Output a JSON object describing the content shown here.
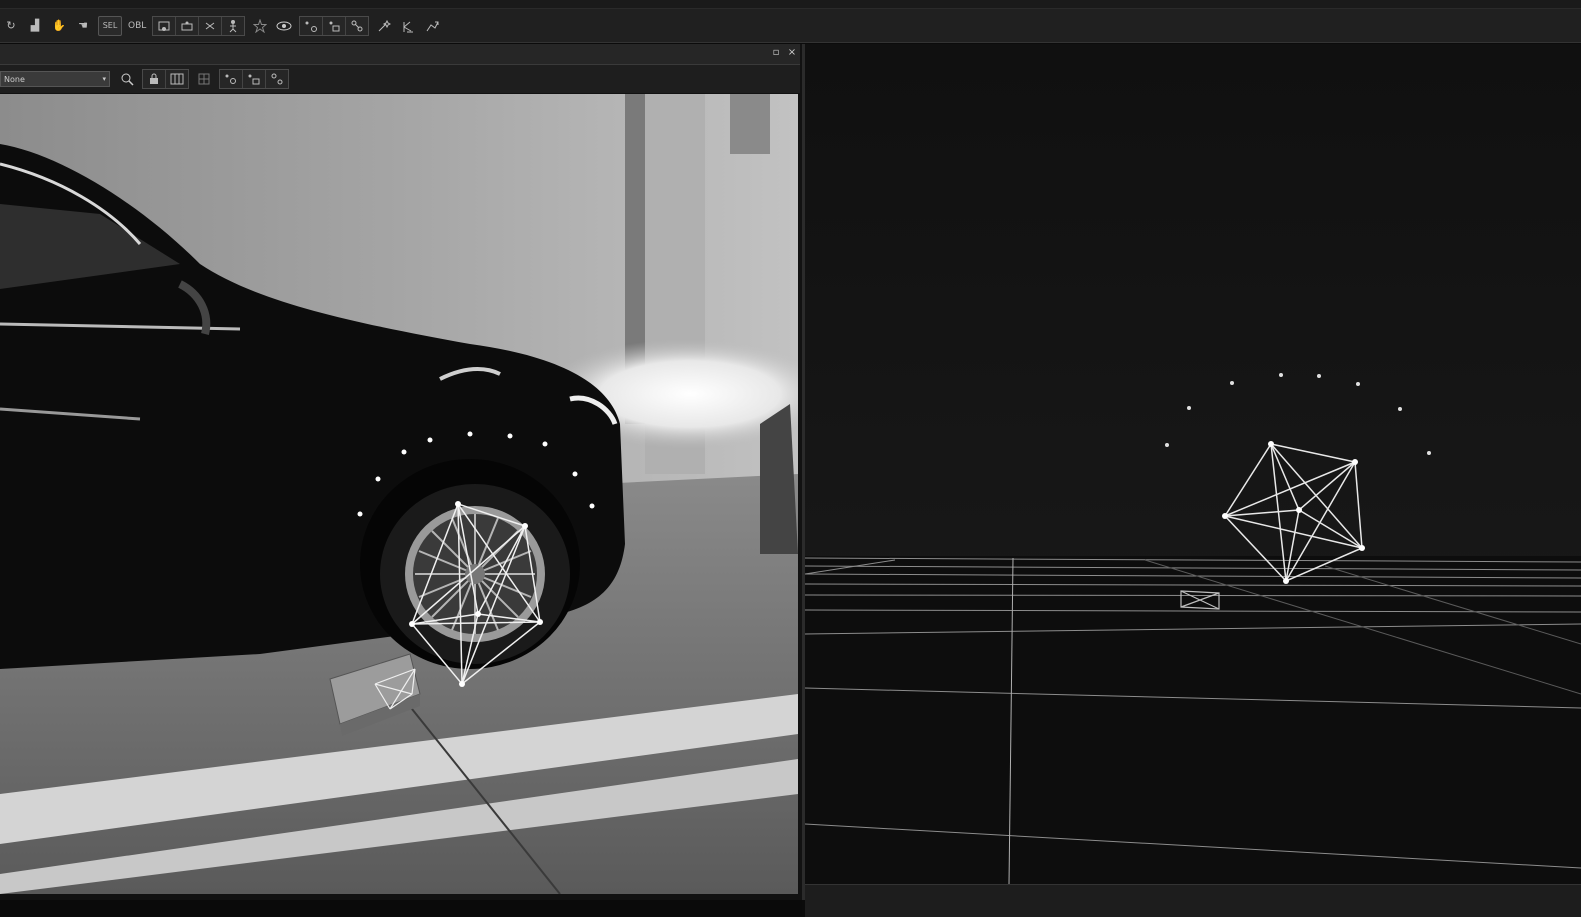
{
  "toolbar": {
    "buttons": [
      {
        "name": "refresh-icon",
        "glyph": "↻"
      },
      {
        "name": "chart-icon",
        "glyph": "▟"
      },
      {
        "name": "hand-tool-icon",
        "glyph": "✋"
      },
      {
        "name": "hand-drag-icon",
        "glyph": "☚"
      }
    ],
    "sel_label": "SEL",
    "obl_label": "OBL",
    "icon_names": [
      "marker-add-icon",
      "marker-select-icon",
      "link-icon",
      "skeleton-icon",
      "star-icon",
      "eye-icon",
      "camera-a-icon",
      "camera-b-icon",
      "camera-c-icon",
      "wand-icon",
      "solve-icon",
      "run-icon"
    ]
  },
  "camera_panel": {
    "restore_glyph": "▫",
    "close_glyph": "×",
    "camera_select": {
      "value": "None"
    },
    "icon_names": [
      "zoom-icon",
      "lock-icon",
      "columns-icon",
      "grid-icon",
      "view-a-icon",
      "view-b-icon",
      "view-c-icon"
    ]
  },
  "viewport_3d": {
    "background_color": "#151515",
    "grid_color": "#9a9a9a",
    "marker_color": "#e0e0e0"
  }
}
